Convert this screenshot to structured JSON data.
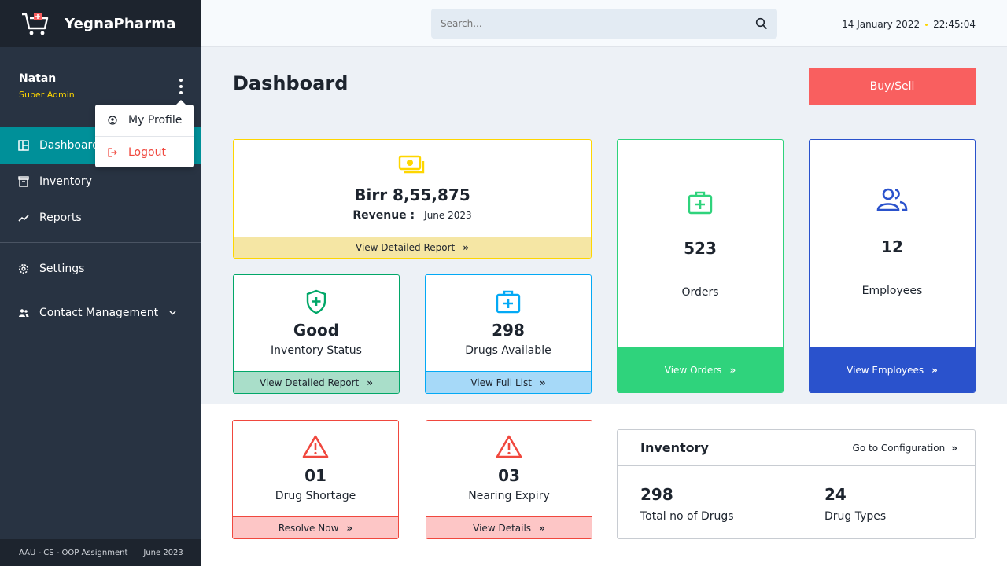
{
  "brand": {
    "name": "YegnaPharma"
  },
  "user": {
    "name": "Natan",
    "role": "Super Admin"
  },
  "profile_menu": {
    "my_profile": "My Profile",
    "logout": "Logout"
  },
  "nav": {
    "dashboard": "Dashboard",
    "inventory": "Inventory",
    "reports": "Reports",
    "settings": "Settings",
    "contact_management": "Contact Management"
  },
  "footer": {
    "text": "AAU - CS - OOP Assignment",
    "date": "June 2023"
  },
  "header": {
    "search_placeholder": "Search...",
    "date": "14 January 2022",
    "time": "22:45:04"
  },
  "page": {
    "title": "Dashboard",
    "buy_sell": "Buy/Sell"
  },
  "cards": {
    "revenue": {
      "value": "Birr 8,55,875",
      "label": "Revenue :",
      "period": "June 2023",
      "link": "View Detailed Report"
    },
    "inventory_status": {
      "value": "Good",
      "label": "Inventory Status",
      "link": "View Detailed Report"
    },
    "drugs_available": {
      "value": "298",
      "label": "Drugs Available",
      "link": "View Full List"
    },
    "orders": {
      "value": "523",
      "label": "Orders",
      "link": "View Orders"
    },
    "employees": {
      "value": "12",
      "label": "Employees",
      "link": "View Employees"
    },
    "drug_shortage": {
      "value": "01",
      "label": "Drug Shortage",
      "link": "Resolve Now"
    },
    "nearing_expiry": {
      "value": "03",
      "label": "Nearing Expiry",
      "link": "View Details"
    }
  },
  "inventory_panel": {
    "title": "Inventory",
    "link": "Go to Configuration",
    "total_drugs": {
      "value": "298",
      "label": "Total no of Drugs"
    },
    "drug_types": {
      "value": "24",
      "label": "Drug Types"
    }
  },
  "colors": {
    "sidebar": "#283342",
    "accent": "#009099",
    "revenue": "#fed600",
    "green": "#03a9f5",
    "orders": "#2fd37c",
    "employees": "#2a52cc",
    "alert": "#f0483e",
    "buy_sell": "#f95f5f"
  },
  "icons": {
    "logo": "pharmacy-cart-icon",
    "kebab": "more-vertical-icon",
    "search": "search-icon"
  }
}
